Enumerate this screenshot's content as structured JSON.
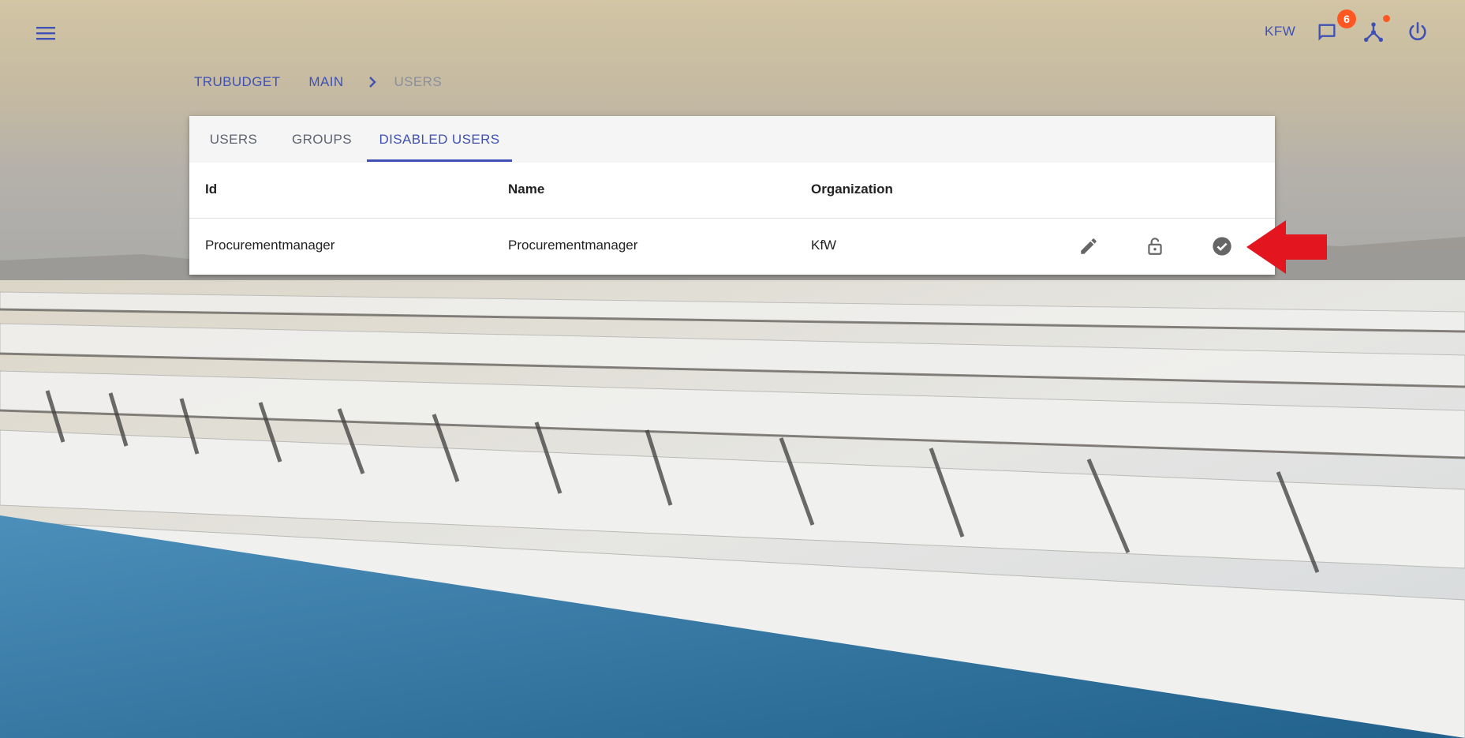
{
  "header": {
    "organization": "KFW",
    "notification_count": "6",
    "icons": {
      "menu": "menu-icon",
      "notifications": "chat-bubble-icon",
      "network": "network-icon",
      "logout": "power-icon"
    }
  },
  "breadcrumb": {
    "items": [
      "TRUBUDGET",
      "MAIN",
      "USERS"
    ]
  },
  "tabs": [
    {
      "label": "USERS"
    },
    {
      "label": "GROUPS"
    },
    {
      "label": "DISABLED USERS",
      "active": true
    }
  ],
  "table": {
    "columns": [
      "Id",
      "Name",
      "Organization"
    ],
    "rows": [
      {
        "id": "Procurementmanager",
        "name": "Procurementmanager",
        "organization": "KfW",
        "actions": [
          "edit-icon",
          "unlock-icon",
          "check-circle-icon"
        ]
      }
    ]
  },
  "colors": {
    "primary": "#3f51b5",
    "badge": "#ff5722",
    "annotation_arrow": "#e3161f"
  }
}
